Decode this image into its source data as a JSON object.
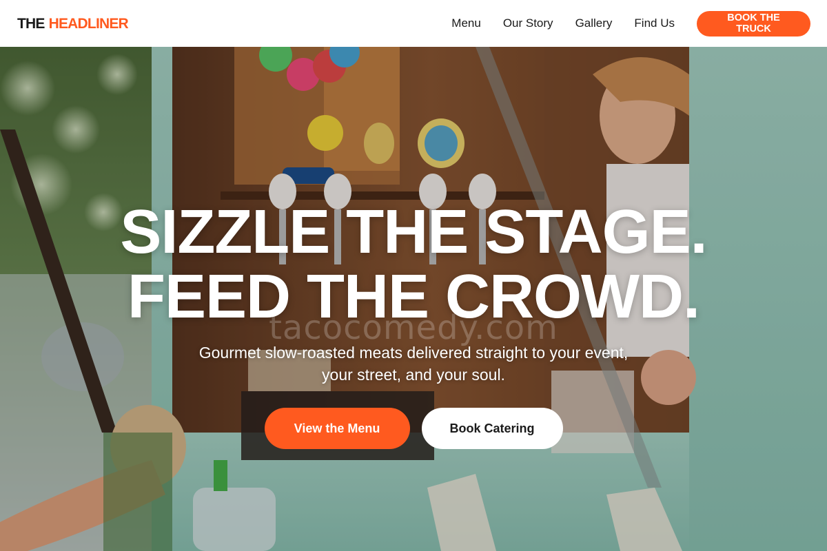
{
  "brand": {
    "logo_part_1": "THE",
    "logo_part_2": "HEADLINER",
    "accent_color": "#ff5a1f",
    "dark_color": "#1a1a1a"
  },
  "nav": {
    "links": [
      "Menu",
      "Our Story",
      "Gallery",
      "Find Us"
    ],
    "cta_label": "BOOK THE TRUCK"
  },
  "hero": {
    "headline_line_1": "SIZZLE THE STAGE.",
    "headline_line_2": "FEED THE CROWD.",
    "subheadline": "Gourmet slow-roasted meats delivered straight to your event, your street, and your soul.",
    "primary_cta": "View the Menu",
    "secondary_cta": "Book Catering",
    "watermark": "tacocomedy.com",
    "background_image": "food-truck-service-window-photo"
  }
}
